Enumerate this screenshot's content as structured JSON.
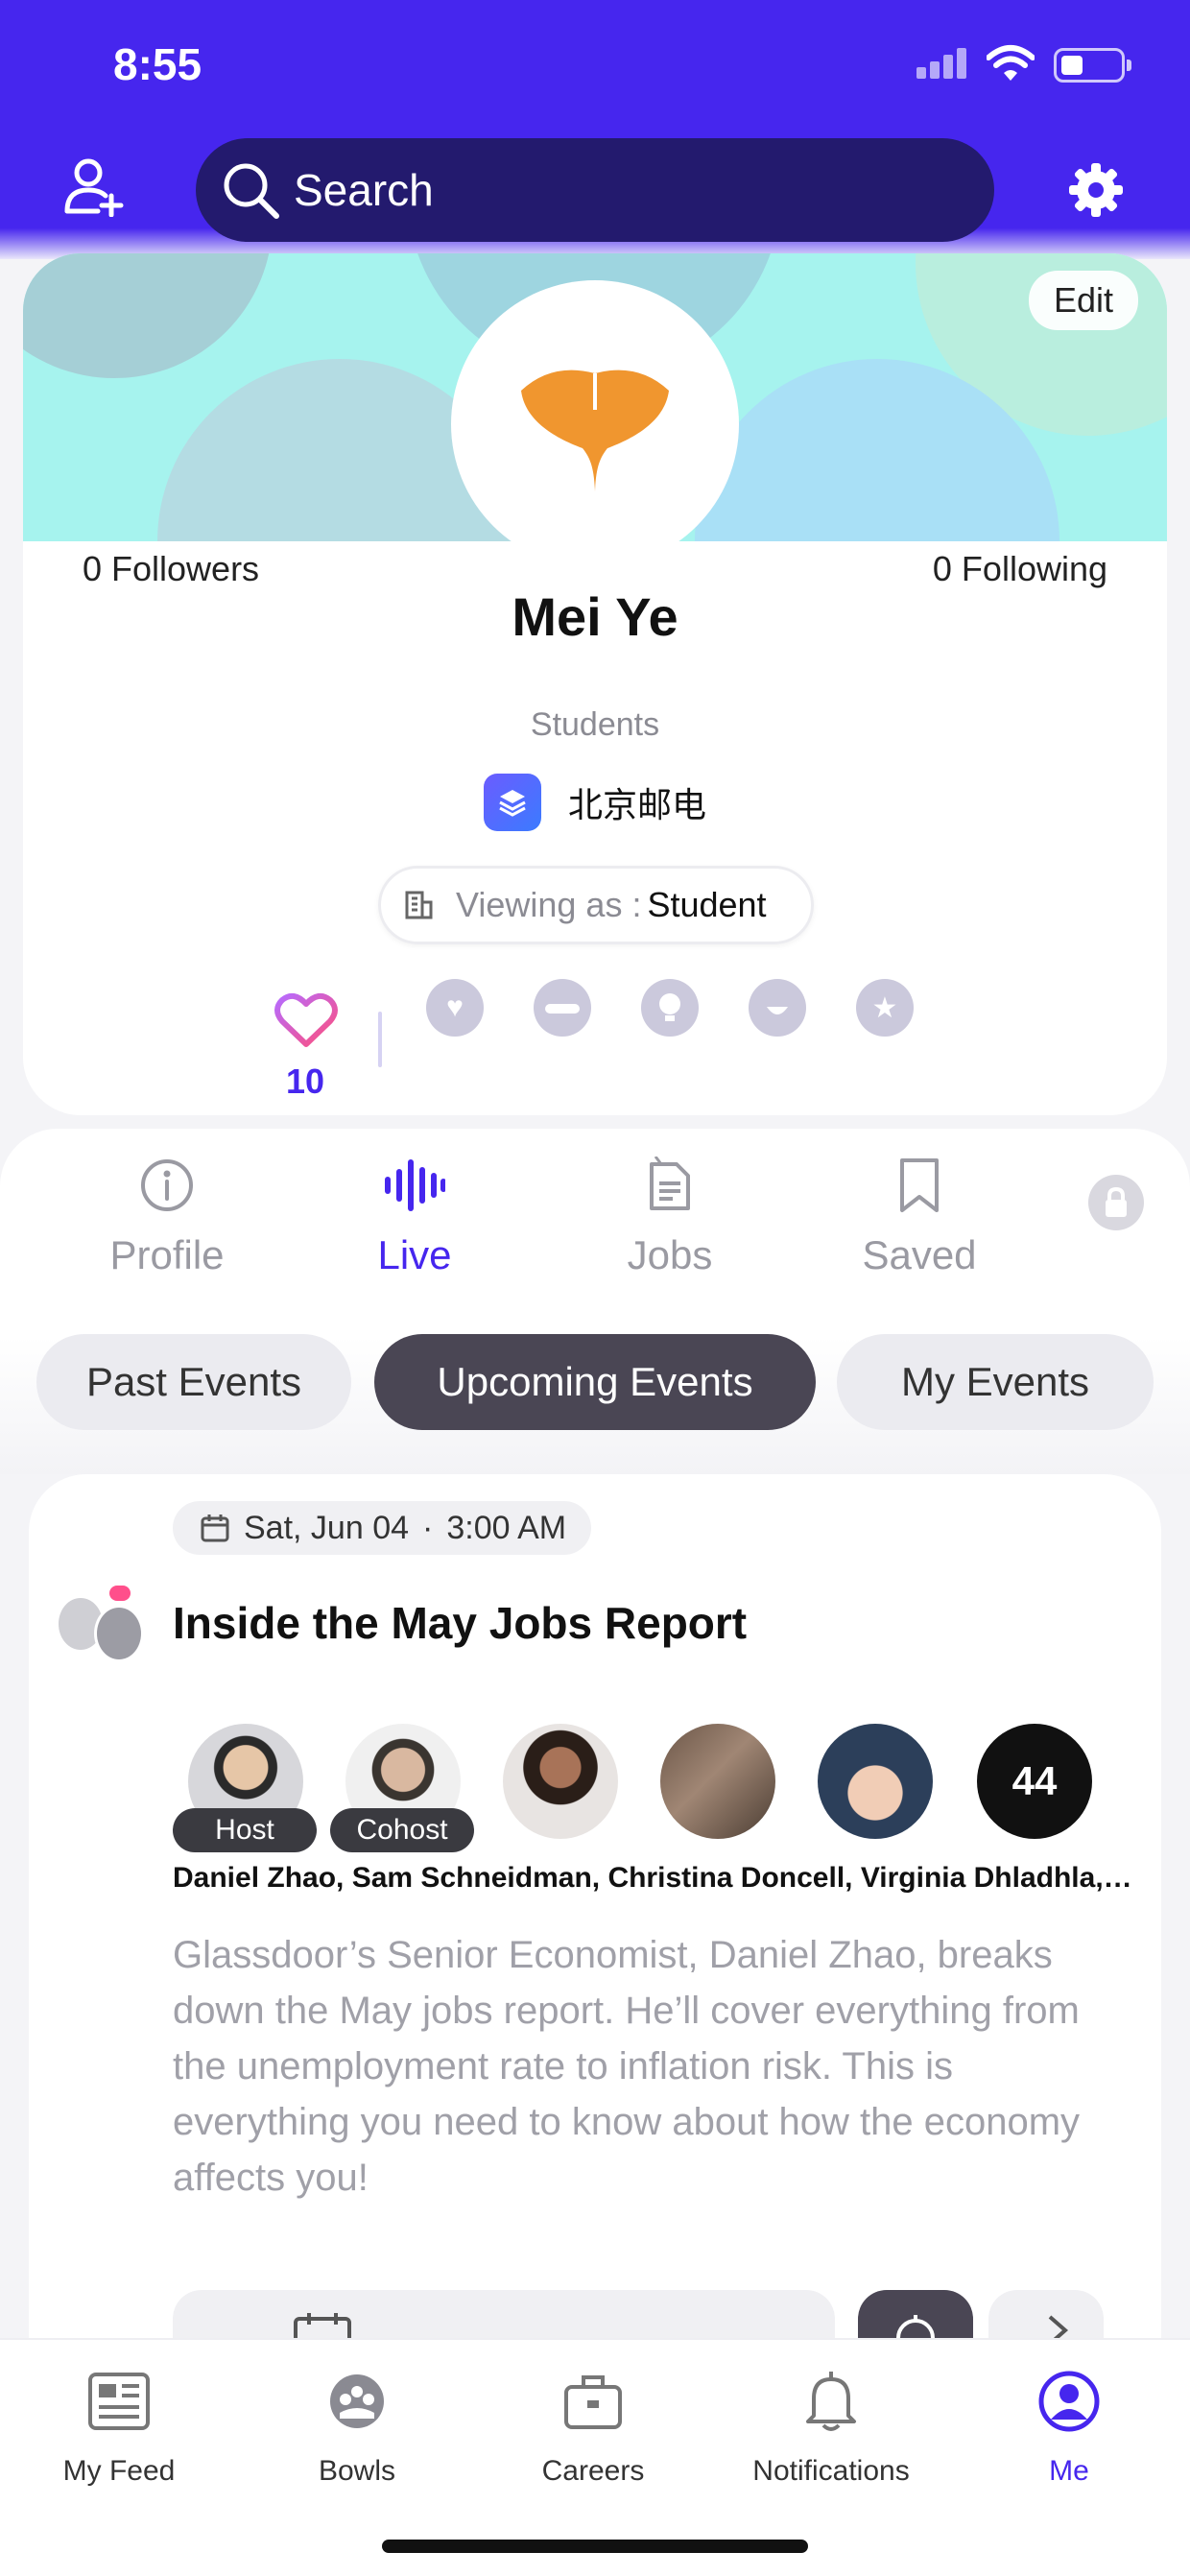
{
  "status_bar": {
    "time": "8:55"
  },
  "header": {
    "search_placeholder": "Search",
    "icons": [
      "add-user-icon",
      "search-icon",
      "gear-icon"
    ]
  },
  "profile": {
    "edit_label": "Edit",
    "followers": "0 Followers",
    "following": "0 Following",
    "name": "Mei Ye",
    "role": "Students",
    "school": "北京邮电",
    "viewing_label": "Viewing as :",
    "viewing_value": "Student",
    "likes": "10"
  },
  "tabs": [
    {
      "label": "Profile",
      "icon": "info-icon"
    },
    {
      "label": "Live",
      "icon": "audio-wave-icon",
      "active": true
    },
    {
      "label": "Jobs",
      "icon": "document-icon"
    },
    {
      "label": "Saved",
      "icon": "bookmark-icon"
    }
  ],
  "segments": [
    {
      "label": "Past Events"
    },
    {
      "label": "Upcoming Events",
      "active": true
    },
    {
      "label": "My Events"
    }
  ],
  "event": {
    "date": "Sat, Jun 04",
    "time": "3:00 AM",
    "title": "Inside the May Jobs Report",
    "host_badge": "Host",
    "cohost_badge": "Cohost",
    "more_count": "44",
    "speakers": "Daniel Zhao, Sam Schneidman, Christina Doncell, Virginia Dhladhla, B...",
    "description": "Glassdoor’s Senior Economist, Daniel Zhao, breaks down the May jobs report. He’ll cover everything from the unemployment rate to inflation risk. This is everything you need to know about how the economy affects you!"
  },
  "bottom_nav": [
    {
      "label": "My Feed",
      "icon": "newspaper-icon"
    },
    {
      "label": "Bowls",
      "icon": "bowl-icon"
    },
    {
      "label": "Careers",
      "icon": "briefcase-icon"
    },
    {
      "label": "Notifications",
      "icon": "bell-icon"
    },
    {
      "label": "Me",
      "icon": "person-icon",
      "active": true
    }
  ],
  "colors": {
    "brand": "#4626ee",
    "dark_pill": "#4a4654",
    "muted": "#9a9aa2"
  }
}
